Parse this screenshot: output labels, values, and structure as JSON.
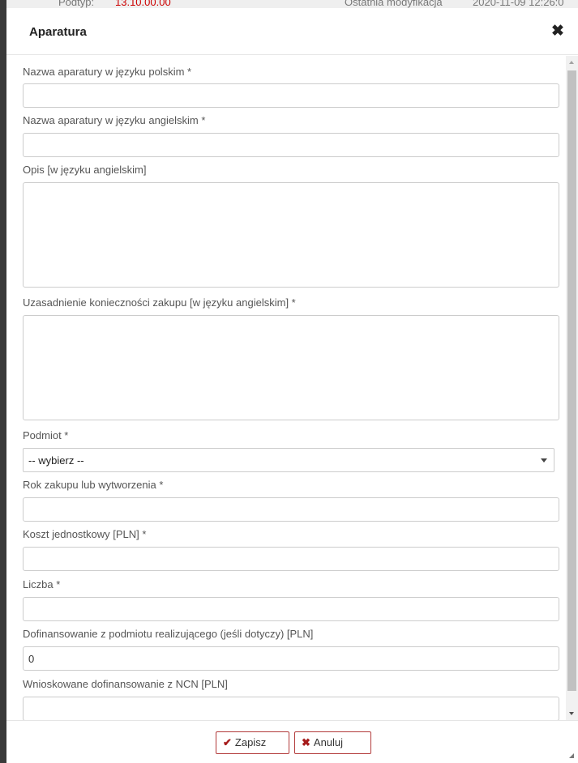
{
  "background": {
    "left_text": "Podtyp:",
    "red_text": "13.10.00.00",
    "right_label": "Ostatnia modyfikacja",
    "right_value": "2020-11-09 12:26:0"
  },
  "modal": {
    "title": "Aparatura",
    "close_icon": "close-icon"
  },
  "form": {
    "name_pl": {
      "label": "Nazwa aparatury w języku polskim *",
      "value": ""
    },
    "name_en": {
      "label": "Nazwa aparatury w języku angielskim *",
      "value": ""
    },
    "description_en": {
      "label": "Opis [w języku angielskim]",
      "value": ""
    },
    "justification_en": {
      "label": "Uzasadnienie konieczności zakupu [w języku angielskim] *",
      "value": ""
    },
    "entity": {
      "label": "Podmiot *",
      "selected": "-- wybierz --"
    },
    "year": {
      "label": "Rok zakupu lub wytworzenia *",
      "value": ""
    },
    "unit_cost": {
      "label": "Koszt jednostkowy [PLN] *",
      "value": ""
    },
    "count": {
      "label": "Liczba *",
      "value": ""
    },
    "cofinancing_entity": {
      "label": "Dofinansowanie z podmiotu realizującego (jeśli dotyczy) [PLN]",
      "value": "0"
    },
    "requested_ncn": {
      "label": "Wnioskowane dofinansowanie z NCN [PLN]",
      "value": ""
    }
  },
  "footer": {
    "save_label": "Zapisz",
    "cancel_label": "Anuluj",
    "save_icon": "check-icon",
    "cancel_icon": "x-icon"
  },
  "colors": {
    "button_border": "#b23a3a",
    "button_icon": "#a61c1c"
  }
}
